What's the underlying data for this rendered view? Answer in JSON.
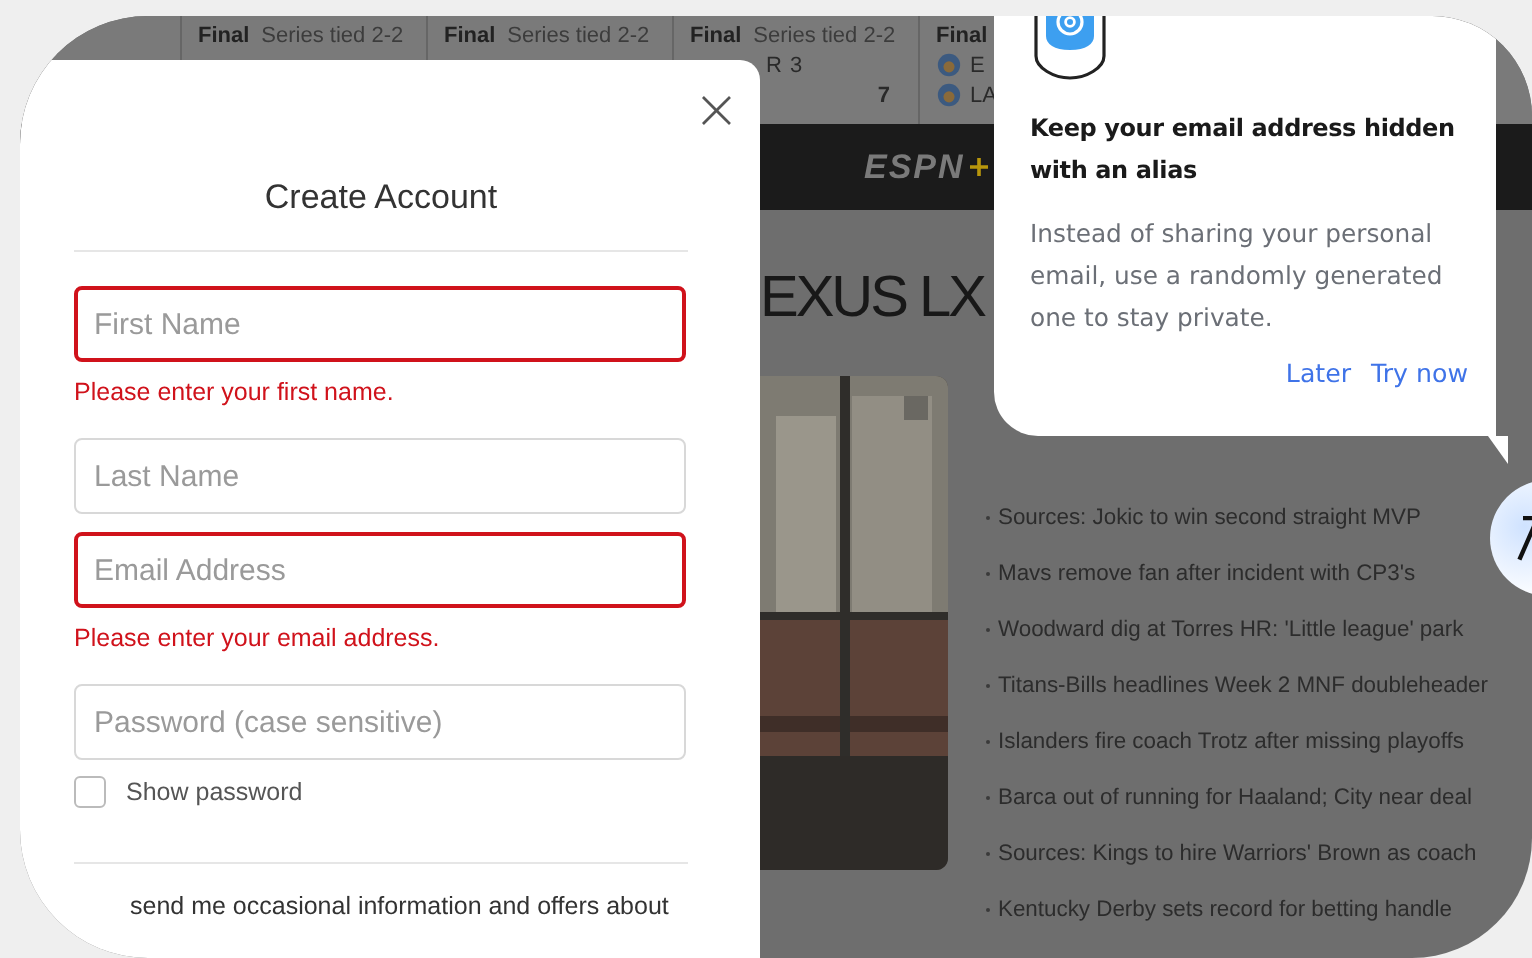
{
  "scoreboard": [
    {
      "status": "Final",
      "note": "Series tied 2-2"
    },
    {
      "status": "Final",
      "note": "Series tied 2-2"
    },
    {
      "status": "Final",
      "note": "Series tied 2-2",
      "teams": [
        {
          "abbr": "R",
          "score": "3",
          "winner": false
        },
        {
          "score": "7",
          "winner": true
        }
      ]
    },
    {
      "status": "Final",
      "teams": [
        {
          "abbr": "E",
          "logo": true
        },
        {
          "abbr": "LA",
          "logo": true
        }
      ]
    }
  ],
  "nav": {
    "logo": "ESPN"
  },
  "headline": "EXUS LX",
  "headlines": [
    "Sources: Jokic to win second straight MVP",
    "Mavs remove fan after incident with CP3's",
    "Woodward dig at Torres HR: 'Little league' park",
    "Titans-Bills headlines Week 2 MNF doubleheader",
    "Islanders fire coach Trotz after missing playoffs",
    "Barca out of running for Haaland; City near deal",
    "Sources: Kings to hire Warriors' Brown as coach",
    "Kentucky Derby sets record for betting handle"
  ],
  "modal": {
    "title": "Create Account",
    "close": "×",
    "fields": [
      {
        "placeholder": "First Name",
        "invalid": true,
        "error": "Please enter your first name."
      },
      {
        "placeholder": "Last Name",
        "invalid": false
      },
      {
        "placeholder": "Email Address",
        "invalid": true,
        "error": "Please enter your email address."
      },
      {
        "placeholder": "Password (case sensitive)",
        "invalid": false
      }
    ],
    "show_password": {
      "label": "Show password",
      "checked": false
    },
    "consent": "send me occasional information and offers about"
  },
  "popup": {
    "title": "Keep your email address hidden with an alias",
    "body": "Instead of sharing your personal email, use a randomly generated one to stay private.",
    "actions": [
      "Later",
      "Try now"
    ]
  }
}
